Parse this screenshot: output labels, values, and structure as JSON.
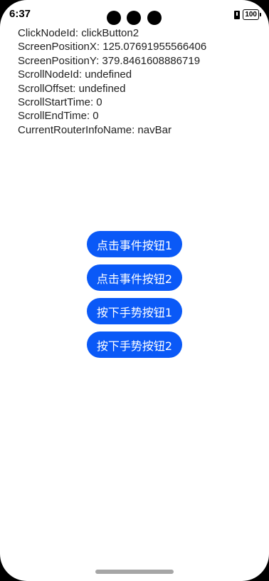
{
  "status_bar": {
    "time": "6:37",
    "battery": "100"
  },
  "info_lines": [
    "ClickNodeId: clickButton2",
    "ScreenPositionX: 125.07691955566406",
    "ScreenPositionY: 379.8461608886719",
    "ScrollNodeId: undefined",
    "ScrollOffset: undefined",
    "ScrollStartTime: 0",
    "ScrollEndTime: 0",
    "CurrentRouterInfoName: navBar"
  ],
  "buttons": [
    "点击事件按钮1",
    "点击事件按钮2",
    "按下手势按钮1",
    "按下手势按钮2"
  ],
  "colors": {
    "button_background": "#0a59f7",
    "button_text": "#ffffff",
    "page_background": "#ffffff"
  }
}
